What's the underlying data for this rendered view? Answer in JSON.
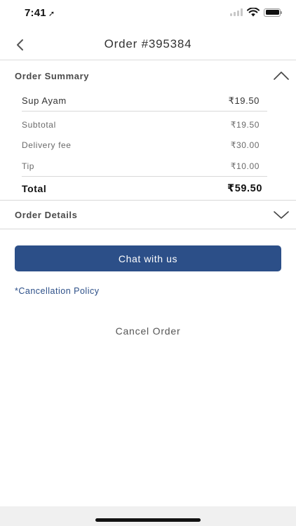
{
  "status_bar": {
    "time": "7:41",
    "location_glyph": "➚"
  },
  "nav": {
    "title": "Order #395384",
    "back_icon": "chevron-left-icon"
  },
  "order_summary": {
    "header": "Order Summary",
    "expanded": true,
    "item": {
      "name": "Sup Ayam",
      "price": "₹19.50"
    },
    "subtotal": {
      "label": "Subtotal",
      "value": "₹19.50"
    },
    "delivery_fee": {
      "label": "Delivery fee",
      "value": "₹30.00"
    },
    "tip": {
      "label": "Tip",
      "value": "₹10.00"
    },
    "total": {
      "label": "Total",
      "value": "₹59.50"
    }
  },
  "order_details": {
    "header": "Order Details",
    "expanded": false
  },
  "actions": {
    "chat_label": "Chat with us",
    "cancellation_policy": "*Cancellation Policy",
    "cancel_order": "Cancel Order"
  },
  "colors": {
    "accent": "#2c4f88",
    "divider": "#d8d8d8",
    "background": "#ffffff"
  }
}
